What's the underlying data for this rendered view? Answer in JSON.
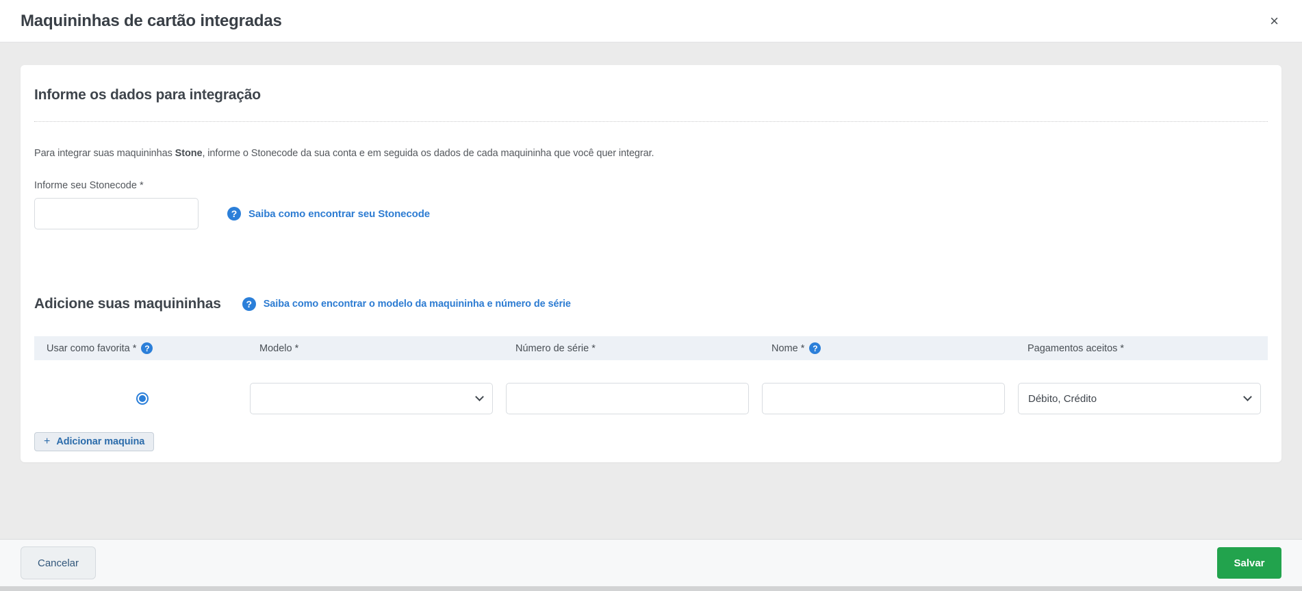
{
  "header": {
    "title": "Maquininhas de cartão integradas",
    "close_glyph": "×"
  },
  "integration_section": {
    "title": "Informe os dados para integração",
    "description_prefix": "Para integrar suas maquininhas ",
    "description_bold": "Stone",
    "description_suffix": ", informe o Stonecode da sua conta e em seguida os dados de cada maquininha que você quer integrar.",
    "stonecode_label": "Informe seu Stonecode *",
    "stonecode_value": "",
    "help_icon_glyph": "?",
    "help_link": "Saiba como encontrar seu Stonecode"
  },
  "machines_section": {
    "title": "Adicione suas maquininhas",
    "help_icon_glyph": "?",
    "help_link": "Saiba como encontrar o modelo da maquininha e número de série",
    "table": {
      "headers": [
        "Usar como favorita *",
        "Modelo *",
        "Número de série *",
        "Nome *",
        "Pagamentos aceitos *"
      ],
      "row": {
        "favorite_selected": true,
        "modelo_value": "",
        "numero_serie_value": "",
        "nome_value": "",
        "pagamentos_value": "Débito, Crédito"
      }
    },
    "add_button": {
      "icon_glyph": "+",
      "label": "Adicionar maquina"
    }
  },
  "footer": {
    "cancel_label": "Cancelar",
    "save_label": "Salvar"
  },
  "colors": {
    "accent_blue": "#2b7fd9",
    "link_blue": "#2d7cd2",
    "success_green": "#22a34d",
    "table_header_bg": "#edf1f6",
    "body_bg": "#ebebeb"
  }
}
